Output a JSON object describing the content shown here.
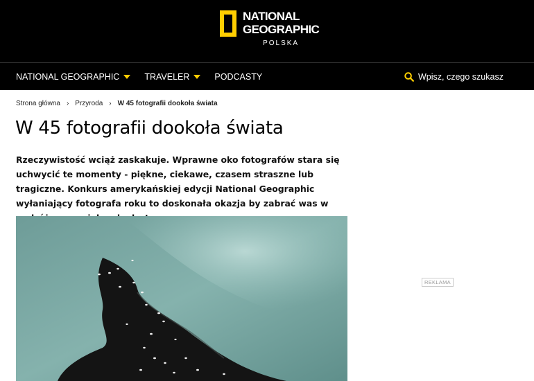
{
  "logo": {
    "line1": "NATIONAL",
    "line2": "GEOGRAPHIC",
    "sub": "POLSKA",
    "frame_color": "#FFCE00"
  },
  "nav": {
    "items": [
      {
        "label": "NATIONAL GEOGRAPHIC",
        "dropdown": true
      },
      {
        "label": "TRAVELER",
        "dropdown": true
      },
      {
        "label": "PODCASTY",
        "dropdown": false
      }
    ],
    "search_placeholder": "Wpisz, czego szukasz",
    "search_icon": "search-icon",
    "accent": "#FFCE00"
  },
  "breadcrumb": {
    "items": [
      "Strona główna",
      "Przyroda"
    ],
    "current": "W 45 fotografii dookoła świata",
    "separator": "›"
  },
  "article": {
    "title": "W 45 fotografii dookoła świata",
    "lead": "Rzeczywistość wciąż zaskakuje. Wprawne oko fotografów stara się uchwycić te momenty - piękne, ciekawe, czasem straszne lub tragiczne. Konkurs amerykańskiej edycji National Geographic wyłaniający fotografa roku to doskonała okazja by zabrać was w podróż przez piękne kadry!"
  },
  "ad": {
    "label": "REKLAMA"
  }
}
